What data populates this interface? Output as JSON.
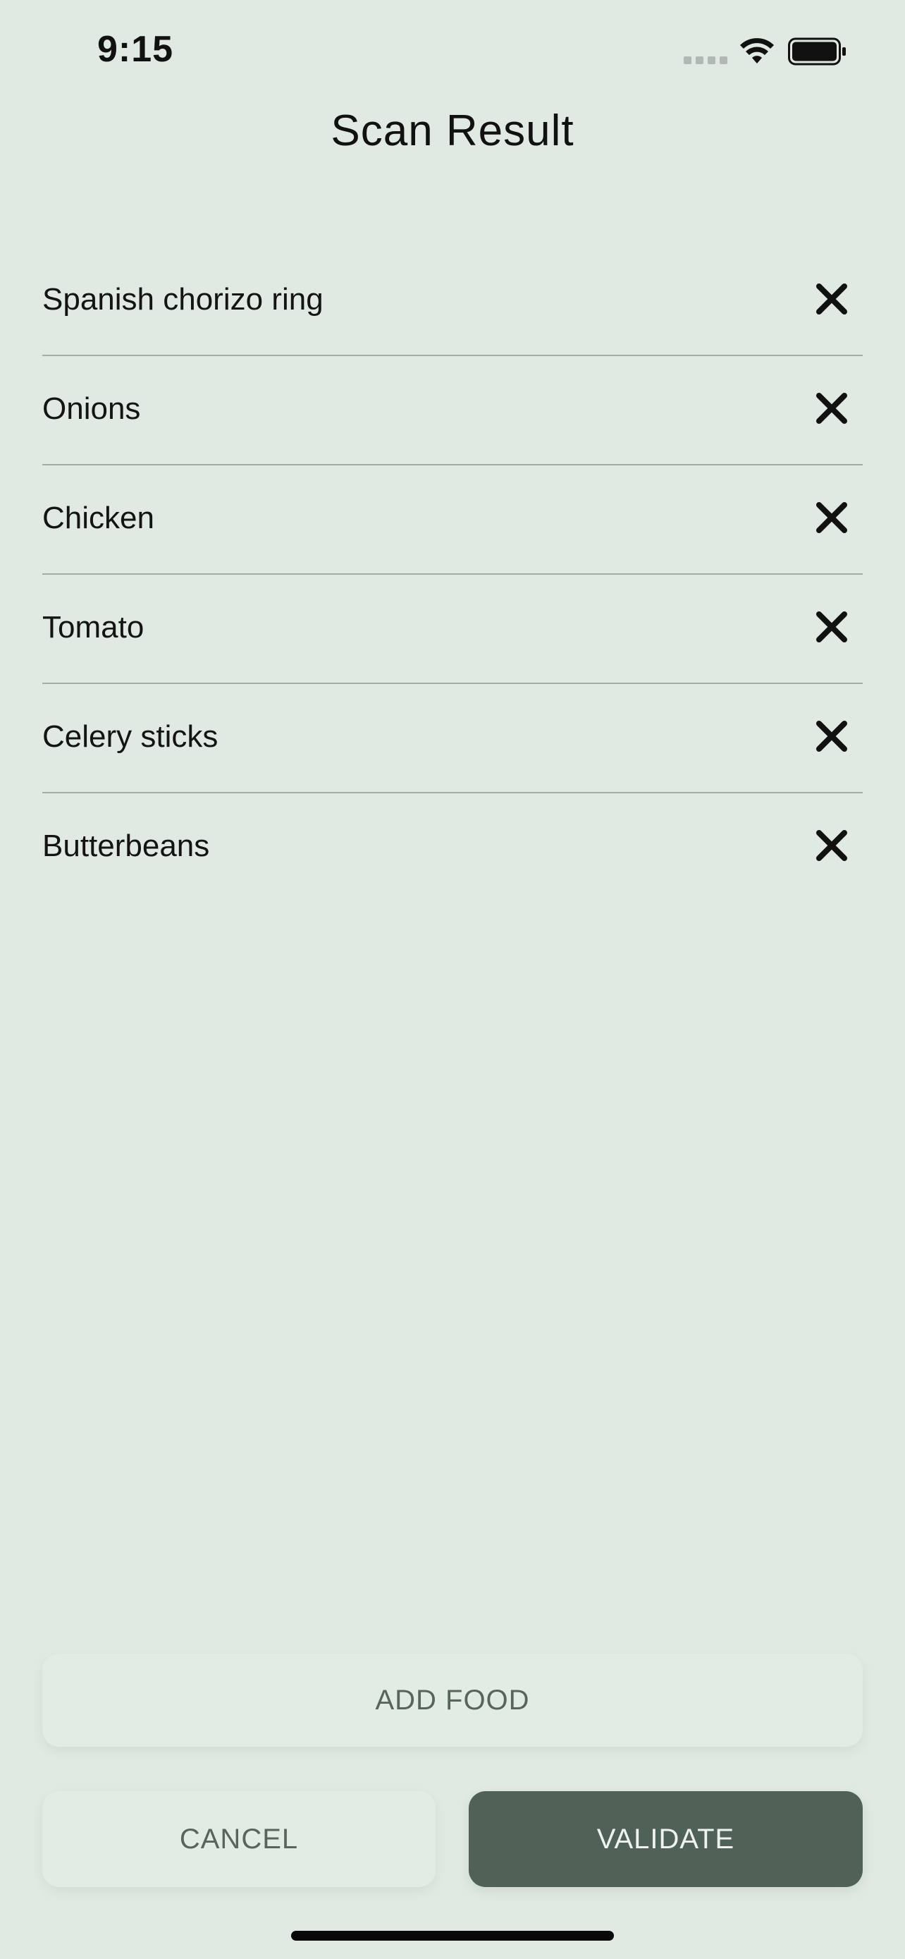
{
  "status_bar": {
    "time": "9:15"
  },
  "header": {
    "title": "Scan Result"
  },
  "food_list": {
    "items": [
      {
        "label": "Spanish chorizo ring"
      },
      {
        "label": "Onions"
      },
      {
        "label": "Chicken"
      },
      {
        "label": "Tomato"
      },
      {
        "label": "Celery sticks"
      },
      {
        "label": "Butterbeans"
      }
    ]
  },
  "actions": {
    "add_food_label": "ADD FOOD",
    "cancel_label": "CANCEL",
    "validate_label": "VALIDATE"
  },
  "colors": {
    "background": "#e0e9e2",
    "primary_button": "#506157",
    "secondary_button": "#e3ebe5",
    "divider": "#a4aca6"
  },
  "icons": {
    "remove": "close-icon",
    "signal": "cellular-signal-icon",
    "wifi": "wifi-icon",
    "battery": "battery-icon"
  }
}
